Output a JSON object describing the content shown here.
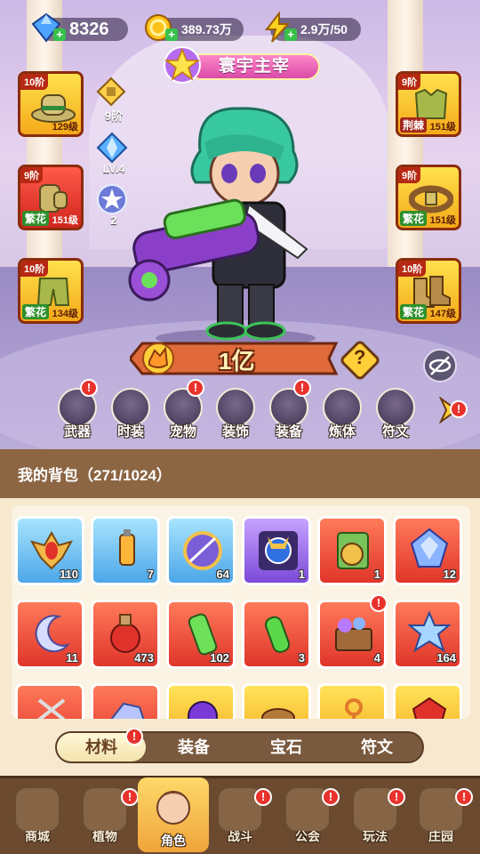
{
  "resources": {
    "diamonds": "8326",
    "gold": "389.73万",
    "energy": "2.9万/50"
  },
  "title_badge": "寰宇主宰",
  "left_slots": [
    {
      "tier": "10阶",
      "level": "129级",
      "tag": ""
    },
    {
      "tier": "9阶",
      "level": "151级",
      "tag": "繁花"
    },
    {
      "tier": "10阶",
      "level": "134级",
      "tag": "繁花"
    }
  ],
  "right_slots": [
    {
      "tier": "9阶",
      "level": "151级",
      "tag": "荆棘"
    },
    {
      "tier": "9阶",
      "level": "151级",
      "tag": "繁花"
    },
    {
      "tier": "10阶",
      "level": "147级",
      "tag": "繁花"
    }
  ],
  "side_badges": {
    "weapon_tier": "9阶",
    "crystal_level": "LV.4",
    "star_count": "2"
  },
  "power": "1亿",
  "help_symbol": "?",
  "menu": [
    {
      "label": "武器",
      "badge": "!"
    },
    {
      "label": "时装",
      "badge": ""
    },
    {
      "label": "宠物",
      "badge": "!"
    },
    {
      "label": "装饰",
      "badge": ""
    },
    {
      "label": "装备",
      "badge": "!"
    },
    {
      "label": "炼体",
      "badge": ""
    },
    {
      "label": "符文",
      "badge": ""
    }
  ],
  "menu_more_badge": "!",
  "bag": {
    "title": "我的背包（271/1024）",
    "row1": [
      "110",
      "7",
      "64",
      "1",
      "1",
      "12"
    ],
    "row2": [
      "11",
      "473",
      "102",
      "3",
      "4",
      "164"
    ],
    "row2_badge": "!"
  },
  "tabs": [
    {
      "label": "材料",
      "badge": "!"
    },
    {
      "label": "装备",
      "badge": ""
    },
    {
      "label": "宝石",
      "badge": ""
    },
    {
      "label": "符文",
      "badge": ""
    }
  ],
  "nav": [
    {
      "label": "商城",
      "badge": ""
    },
    {
      "label": "植物",
      "badge": "!"
    },
    {
      "label": "角色",
      "badge": ""
    },
    {
      "label": "战斗",
      "badge": "!"
    },
    {
      "label": "公会",
      "badge": "!"
    },
    {
      "label": "玩法",
      "badge": "!"
    },
    {
      "label": "庄园",
      "badge": "!"
    }
  ]
}
